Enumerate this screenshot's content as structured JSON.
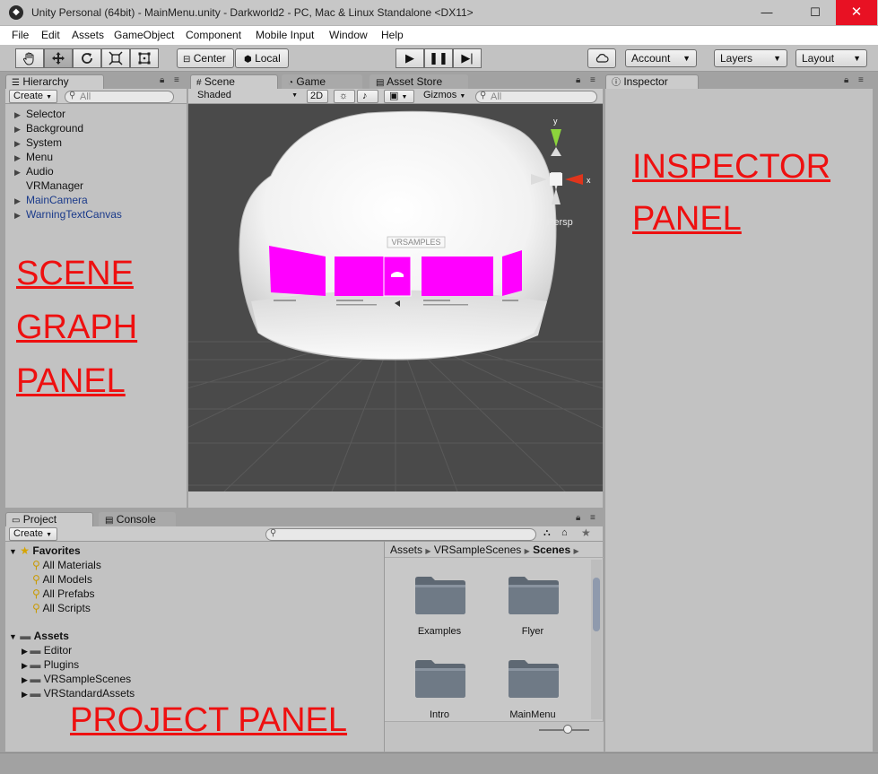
{
  "window": {
    "title": "Unity Personal (64bit) - MainMenu.unity - Darkworld2 - PC, Mac & Linux Standalone <DX11>",
    "minimize": "—",
    "maximize": "☐",
    "close": "✕"
  },
  "menu": [
    "File",
    "Edit",
    "Assets",
    "GameObject",
    "Component",
    "Mobile Input",
    "Window",
    "Help"
  ],
  "toolbar": {
    "tools": [
      "hand-icon",
      "move-icon",
      "rotate-icon",
      "scale-icon",
      "rect-icon"
    ],
    "pivot": "Center",
    "space": "Local",
    "play": "▶",
    "pause": "❚❚",
    "step": "▶|",
    "account": "Account",
    "layers": "Layers",
    "layout": "Layout"
  },
  "hierarchy": {
    "tab": "Hierarchy",
    "create": "Create",
    "search_placeholder": "All",
    "items": [
      {
        "label": "Selector",
        "expandable": true,
        "blue": false
      },
      {
        "label": "Background",
        "expandable": true,
        "blue": false
      },
      {
        "label": "System",
        "expandable": true,
        "blue": false
      },
      {
        "label": "Menu",
        "expandable": true,
        "blue": false
      },
      {
        "label": "Audio",
        "expandable": true,
        "blue": false
      },
      {
        "label": "VRManager",
        "expandable": false,
        "blue": false
      },
      {
        "label": "MainCamera",
        "expandable": true,
        "blue": true
      },
      {
        "label": "WarningTextCanvas",
        "expandable": true,
        "blue": true
      }
    ],
    "annotation": [
      "SCENE",
      "GRAPH",
      "PANEL"
    ]
  },
  "scene": {
    "tabs": [
      "Scene",
      "Game",
      "Asset Store"
    ],
    "shading": "Shaded",
    "mode_2d": "2D",
    "gizmos": "Gizmos",
    "search_placeholder": "All",
    "persp": "Persp",
    "gizmo_y": "y",
    "gizmo_x": "x",
    "logo": "VRSAMPLES"
  },
  "inspector": {
    "tab": "Inspector",
    "annotation": [
      "INSPECTOR",
      "PANEL"
    ]
  },
  "project": {
    "tabs": [
      "Project",
      "Console"
    ],
    "create": "Create",
    "favorites_label": "Favorites",
    "favorites": [
      "All Materials",
      "All Models",
      "All Prefabs",
      "All Scripts"
    ],
    "assets_label": "Assets",
    "assets": [
      "Editor",
      "Plugins",
      "VRSampleScenes",
      "VRStandardAssets"
    ],
    "breadcrumb": [
      "Assets",
      "VRSampleScenes",
      "Scenes"
    ],
    "folders": [
      "Examples",
      "Flyer",
      "Intro",
      "MainMenu"
    ],
    "annotation": "PROJECT PANEL"
  },
  "colors": {
    "annotation": "#ee1010",
    "magenta": "#ff00ff",
    "close_red": "#e81123"
  }
}
